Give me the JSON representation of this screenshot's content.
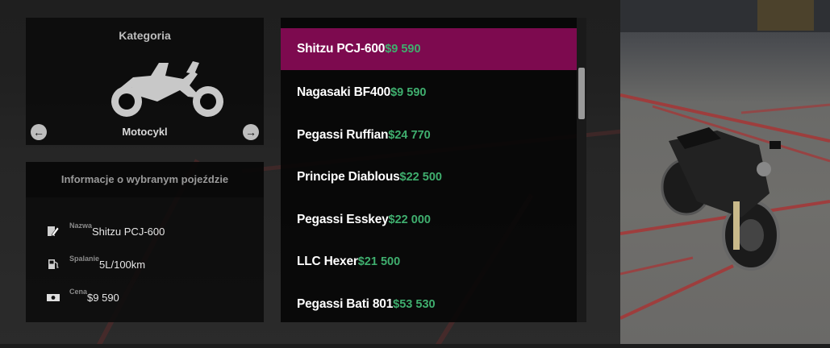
{
  "category": {
    "title": "Kategoria",
    "name": "Motocykl",
    "icon": "motorcycle-icon",
    "prev_icon": "arrow-left-icon",
    "next_icon": "arrow-right-icon"
  },
  "info": {
    "title": "Informacje o wybranym pojeździe",
    "rows": [
      {
        "icon": "edit-document-icon",
        "label": "Nazwa",
        "value": "Shitzu PCJ-600"
      },
      {
        "icon": "fuel-pump-icon",
        "label": "Spalanie",
        "value": "5L/100km"
      },
      {
        "icon": "money-bill-icon",
        "label": "Cena",
        "value": "$9 590"
      }
    ]
  },
  "vehicles": [
    {
      "name": "Shitzu PCJ-600",
      "price": "$9 590",
      "selected": true
    },
    {
      "name": "Nagasaki BF400",
      "price": "$9 590",
      "selected": false
    },
    {
      "name": "Pegassi Ruffian",
      "price": "$24 770",
      "selected": false
    },
    {
      "name": "Principe Diablous",
      "price": "$22 500",
      "selected": false
    },
    {
      "name": "Pegassi Esskey",
      "price": "$22 000",
      "selected": false
    },
    {
      "name": "LLC Hexer",
      "price": "$21 500",
      "selected": false
    },
    {
      "name": "Pegassi Bati 801",
      "price": "$53 530",
      "selected": false
    }
  ],
  "colors": {
    "selected_row": "#7d0a4f",
    "price": "#3fae6e"
  }
}
